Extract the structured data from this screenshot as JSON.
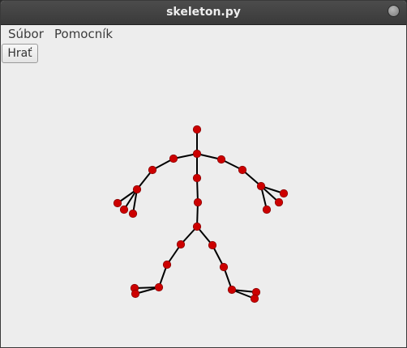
{
  "window": {
    "title": "skeleton.py"
  },
  "menubar": {
    "items": [
      {
        "label": "Súbor"
      },
      {
        "label": "Pomocník"
      }
    ]
  },
  "toolbar": {
    "play_label": "Hrať"
  },
  "skeleton": {
    "joint_color": "#cc0000",
    "bone_color": "#000000"
  }
}
